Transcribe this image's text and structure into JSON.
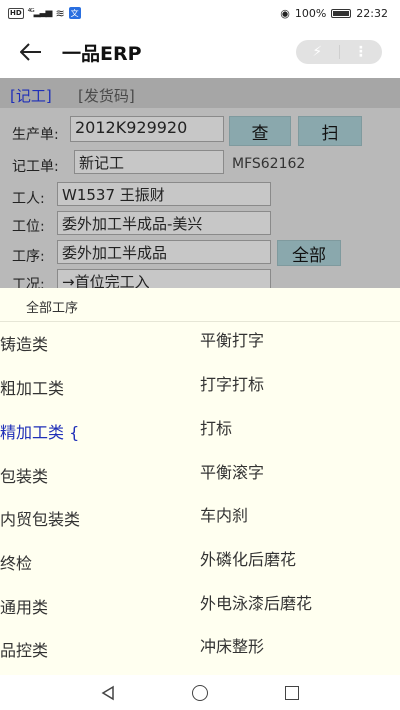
{
  "status_bar": {
    "signal_badge": "HD",
    "network": "4G",
    "battery": "100%",
    "time": "22:32"
  },
  "app_bar": {
    "title": "一品ERP"
  },
  "form": {
    "tabs": [
      "[记工]",
      "[发货码]"
    ],
    "production_order_label": "生产单:",
    "production_order_value": "2012K929920",
    "query_button": "查",
    "scan_button": "扫",
    "work_order_label": "记工单:",
    "work_order_value": "新记工",
    "work_order_code": "MFS62162",
    "worker_label": "工人:",
    "worker_value": "W1537 王振财",
    "station_label": "工位:",
    "station_value": "委外加工半成品-美兴",
    "process_label": "工序:",
    "process_value": "委外加工半成品",
    "all_button": "全部",
    "condition_label": "工况:",
    "condition_value": "→首位完工入"
  },
  "sheet": {
    "title": "全部工序",
    "categories": [
      "铸造类",
      "粗加工类",
      "精加工类 {",
      "包装类",
      "内贸包装类",
      "终检",
      "通用类",
      "品控类"
    ],
    "active_category_index": 2,
    "processes": [
      "平衡打字",
      "打字打标",
      "打标",
      "平衡滚字",
      "车内刹",
      "外磷化后磨花",
      "外电泳漆后磨花",
      "冲床整形"
    ]
  },
  "colors": {
    "active_blue": "#1f2fb8",
    "sheet_bg": "#fffff0",
    "button_teal": "#8aa8ad"
  }
}
